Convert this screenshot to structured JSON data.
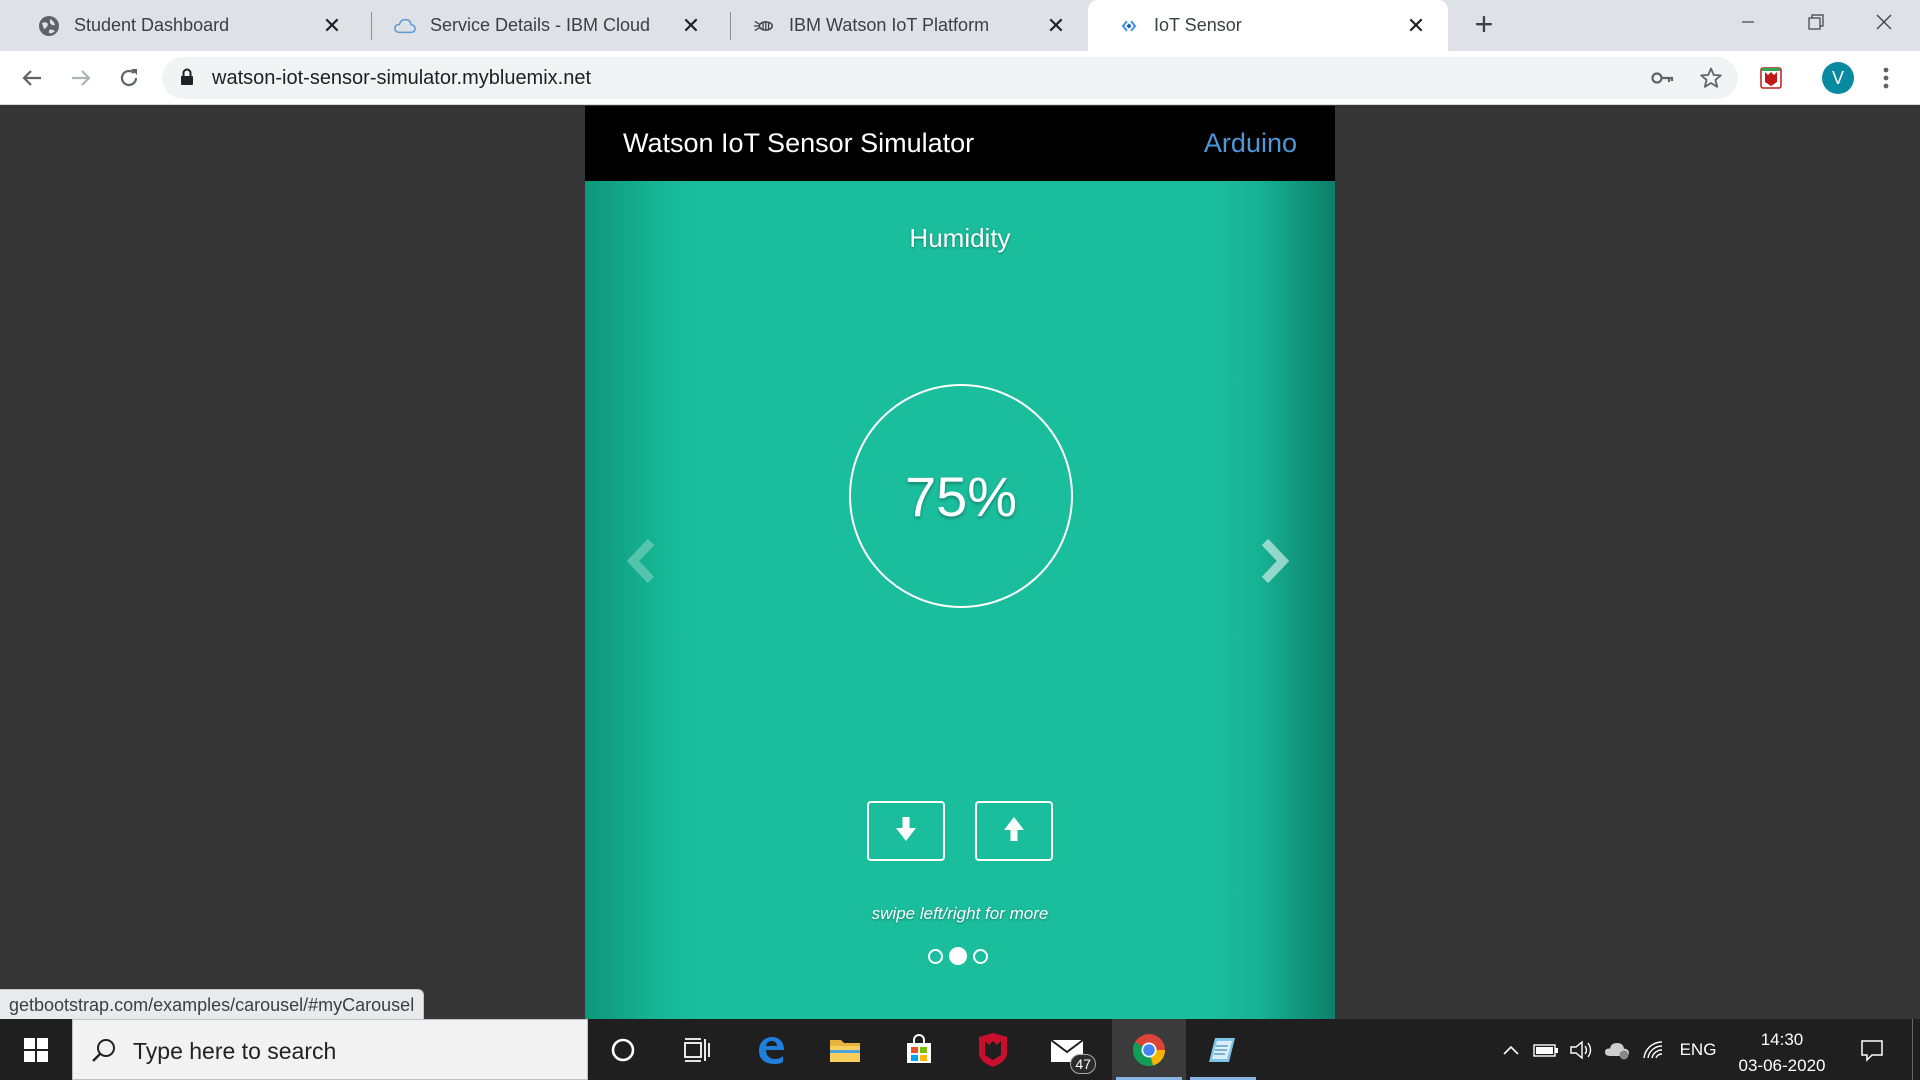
{
  "browser": {
    "tabs": [
      {
        "title": "Student Dashboard",
        "icon": "globe-icon"
      },
      {
        "title": "Service Details - IBM Cloud",
        "icon": "cloud-icon"
      },
      {
        "title": "IBM Watson IoT Platform",
        "icon": "iot-bee-icon"
      },
      {
        "title": "IoT Sensor",
        "icon": "node-red-icon",
        "active": true
      }
    ],
    "url": "watson-iot-sensor-simulator.mybluemix.net",
    "profile_initial": "V",
    "status_url": "getbootstrap.com/examples/carousel/#myCarousel"
  },
  "app": {
    "title": "Watson IoT Sensor Simulator",
    "link": "Arduino",
    "slide": {
      "title": "Humidity",
      "value": "75%",
      "hint": "swipe left/right for more",
      "active_index": 1,
      "count": 3
    }
  },
  "taskbar": {
    "search_placeholder": "Type here to search",
    "mail_badge": "47",
    "language": "ENG",
    "time": "14:30",
    "date": "03-06-2020"
  },
  "colors": {
    "carousel": "#1abd9c",
    "header": "#000000",
    "link": "#4d97d8",
    "page_bg": "#353535"
  }
}
